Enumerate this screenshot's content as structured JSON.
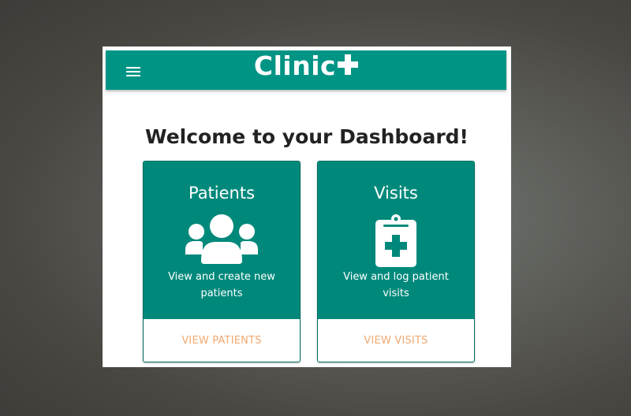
{
  "app": {
    "brand": "Clinic",
    "brand_icon": "plus-icon",
    "menu_icon": "hamburger-menu-icon"
  },
  "main": {
    "welcome": "Welcome to your Dashboard!"
  },
  "cards": [
    {
      "title": "Patients",
      "icon": "users-group-icon",
      "description": "View and create new patients",
      "action": "VIEW PATIENTS"
    },
    {
      "title": "Visits",
      "icon": "medical-clipboard-icon",
      "description": "View and log patient visits",
      "action": "VIEW VISITS"
    }
  ],
  "colors": {
    "header": "#009485",
    "card": "#00897b",
    "action_text": "#f0a870",
    "heading_text": "#222222"
  }
}
